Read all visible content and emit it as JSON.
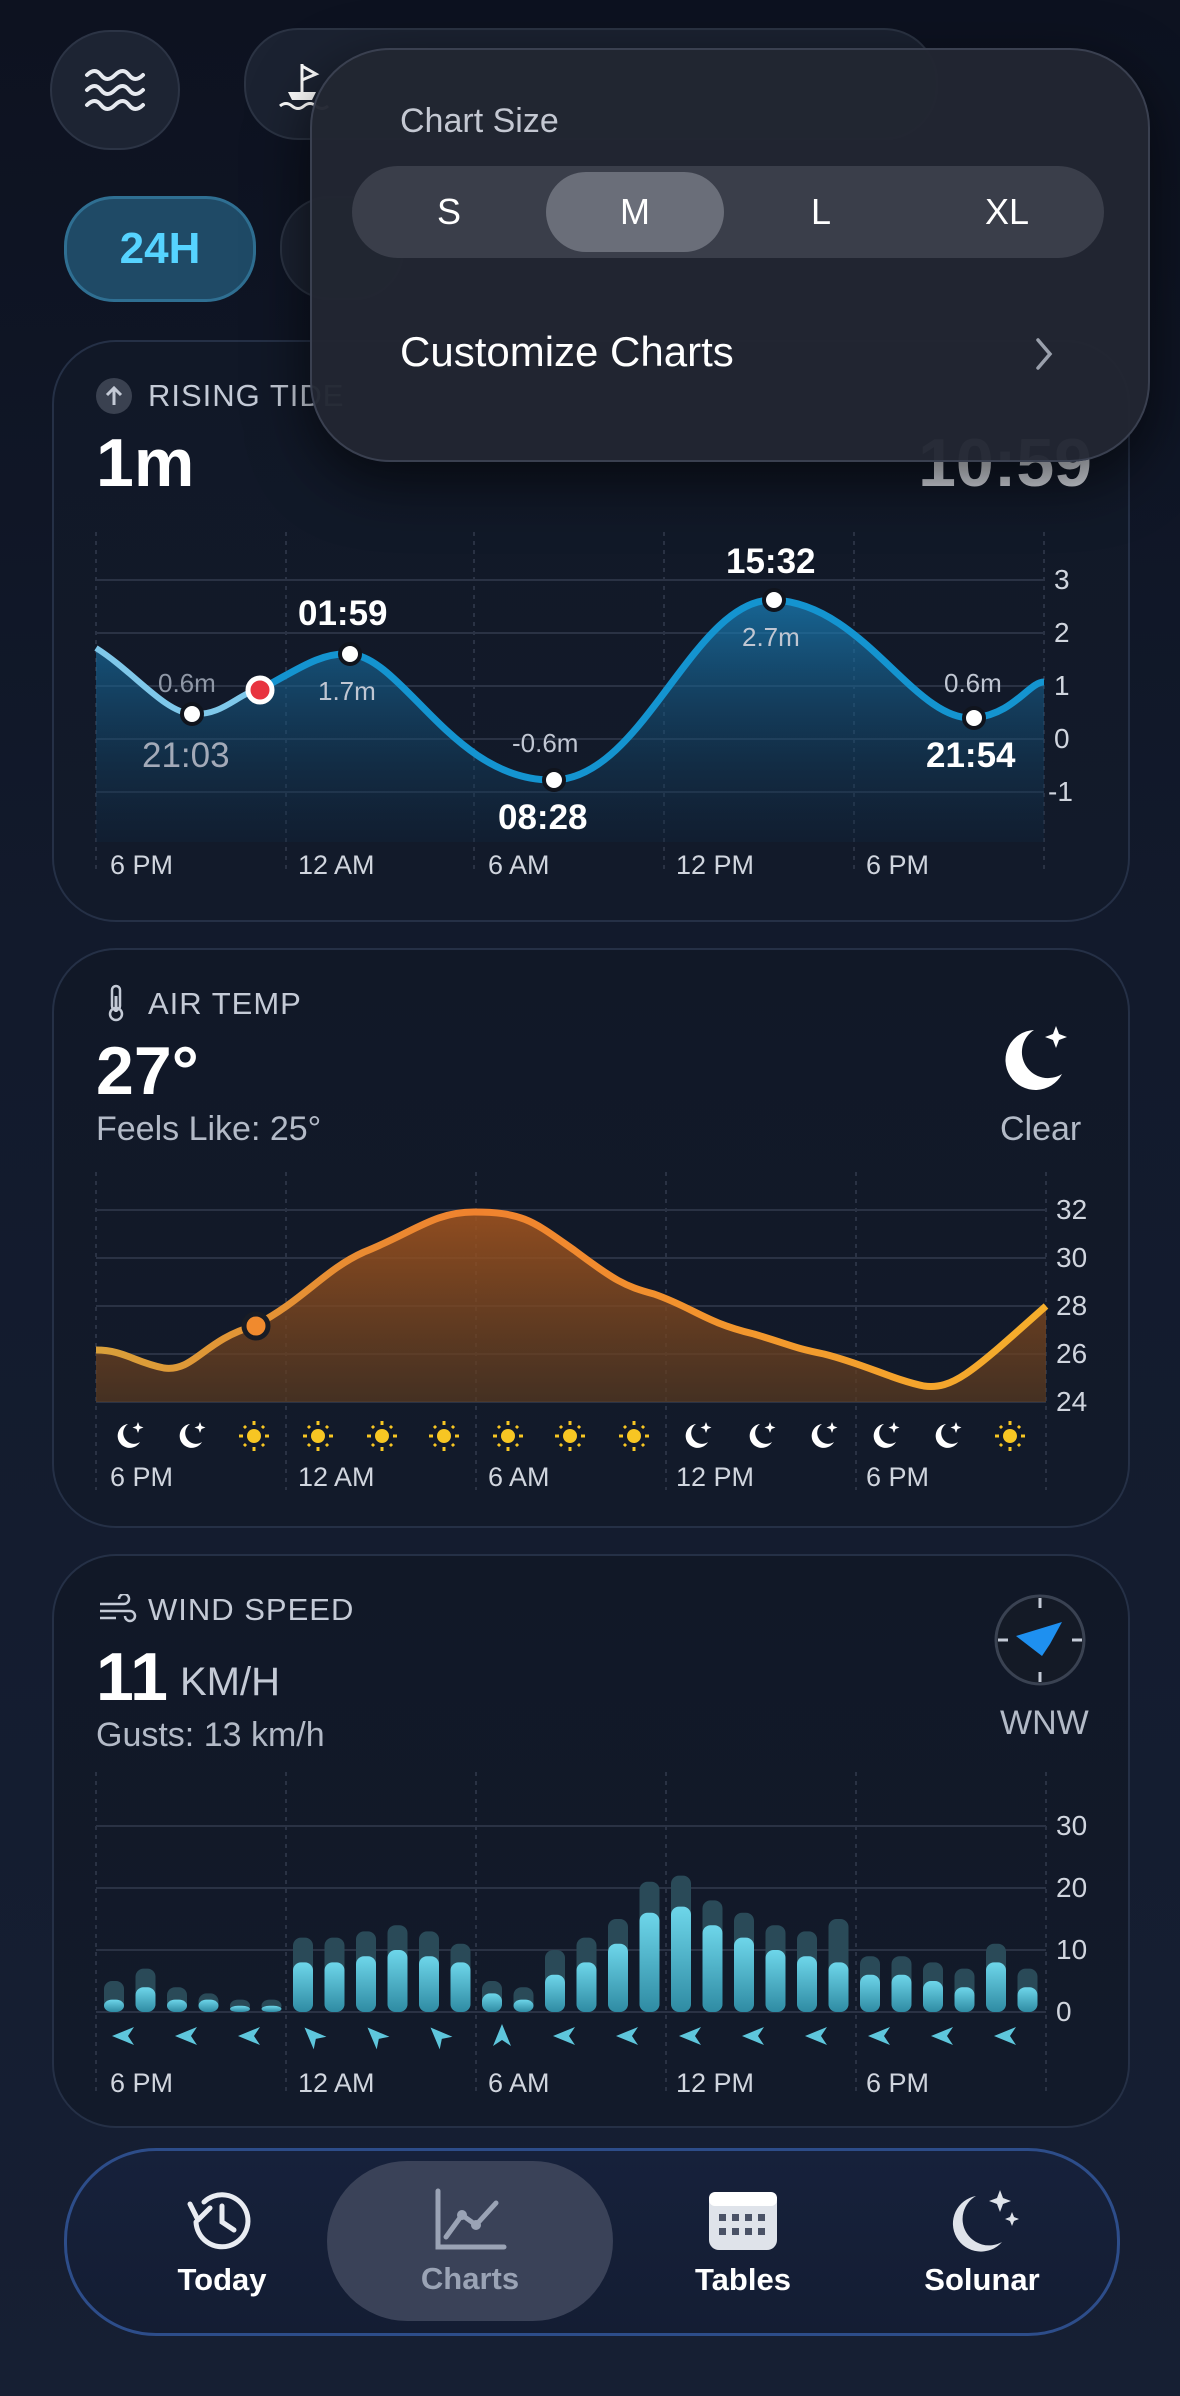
{
  "top": {
    "waves_icon": "waves-icon",
    "station_icon": "buoy-icon"
  },
  "range": {
    "selected": "24H"
  },
  "popup": {
    "title": "Chart Size",
    "sizes": [
      "S",
      "M",
      "L",
      "XL"
    ],
    "selected_size": "M",
    "customize_label": "Customize Charts"
  },
  "tide": {
    "title": "RISING TIDE",
    "value": "1m",
    "time": "10:59",
    "x_ticks": [
      "6 PM",
      "12 AM",
      "6 AM",
      "12 PM",
      "6 PM"
    ],
    "y_ticks": [
      "3",
      "2",
      "1",
      "0",
      "-1"
    ],
    "points": [
      {
        "time": "21:03",
        "height": "0.6m"
      },
      {
        "time": "01:59",
        "height": "1.7m"
      },
      {
        "time": "08:28",
        "height": "-0.6m"
      },
      {
        "time": "15:32",
        "height": "2.7m"
      },
      {
        "time": "21:54",
        "height": "0.6m"
      }
    ]
  },
  "air": {
    "title": "AIR TEMP",
    "value": "27°",
    "feels": "Feels Like: 25°",
    "condition": "Clear",
    "x_ticks": [
      "6 PM",
      "12 AM",
      "6 AM",
      "12 PM",
      "6 PM"
    ],
    "y_ticks": [
      "32",
      "30",
      "28",
      "26",
      "24"
    ]
  },
  "wind": {
    "title": "WIND SPEED",
    "value": "11",
    "unit": "KM/H",
    "gusts": "Gusts: 13 km/h",
    "direction": "WNW",
    "x_ticks": [
      "6 PM",
      "12 AM",
      "6 AM",
      "12 PM",
      "6 PM"
    ],
    "y_ticks": [
      "30",
      "20",
      "10",
      "0"
    ]
  },
  "tabs": [
    {
      "label": "Today",
      "icon": "history-clock-icon"
    },
    {
      "label": "Charts",
      "icon": "line-chart-icon"
    },
    {
      "label": "Tables",
      "icon": "calendar-grid-icon"
    },
    {
      "label": "Solunar",
      "icon": "moon-stars-icon"
    }
  ],
  "chart_data": [
    {
      "type": "area",
      "title": "RISING TIDE",
      "ylim": [
        -1.5,
        3.5
      ],
      "x": [
        "18:00",
        "21:03",
        "22:30",
        "01:59",
        "08:28",
        "15:32",
        "21:54",
        "00:00"
      ],
      "series": [
        {
          "values": [
            1.2,
            0.6,
            0.8,
            1.7,
            -0.6,
            2.7,
            0.6,
            1.0
          ]
        }
      ]
    },
    {
      "type": "area",
      "title": "AIR TEMP",
      "ylim": [
        24,
        33
      ],
      "x": [
        "18:00",
        "20:00",
        "22:00",
        "00:00",
        "02:00",
        "04:00",
        "06:00",
        "08:00",
        "10:00",
        "12:00",
        "14:00",
        "16:00",
        "18:00",
        "20:00"
      ],
      "series": [
        {
          "values": [
            26.2,
            25.8,
            26,
            27.6,
            29.3,
            30.6,
            31.6,
            31,
            29,
            28,
            27.2,
            26.2,
            24.9,
            28
          ]
        }
      ]
    },
    {
      "type": "bar",
      "title": "WIND SPEED",
      "ylim": [
        0,
        30
      ],
      "series": [
        {
          "name": "speed",
          "values": [
            2,
            4,
            2,
            2,
            1,
            1,
            8,
            8,
            9,
            10,
            9,
            8,
            3,
            2,
            6,
            8,
            11,
            16,
            17,
            14,
            12,
            10,
            9,
            8,
            6,
            6,
            5,
            4,
            8,
            4
          ]
        },
        {
          "name": "gusts",
          "values": [
            5,
            7,
            4,
            3,
            2,
            2,
            12,
            12,
            13,
            14,
            13,
            11,
            5,
            4,
            10,
            12,
            15,
            21,
            22,
            18,
            16,
            14,
            13,
            15,
            9,
            9,
            8,
            7,
            11,
            7
          ]
        }
      ]
    }
  ]
}
